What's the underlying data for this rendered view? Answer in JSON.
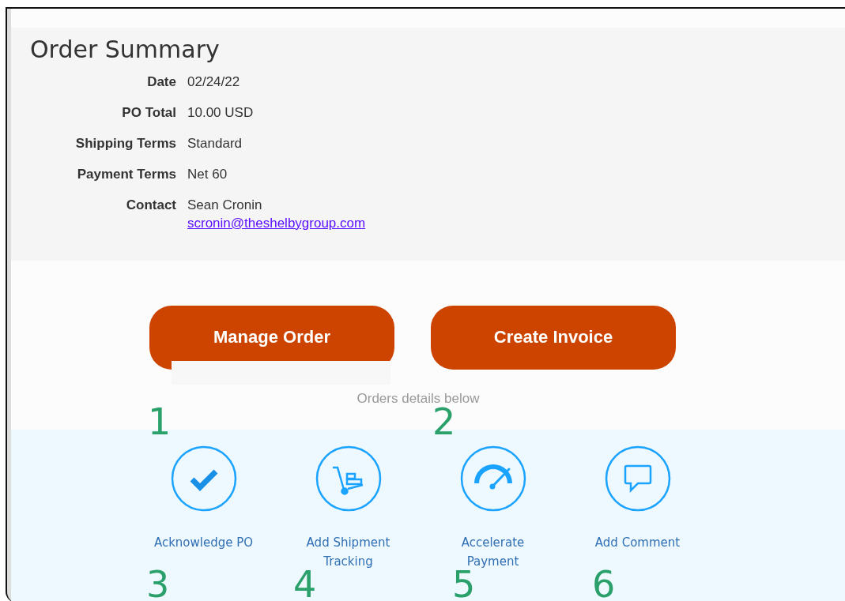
{
  "summary": {
    "title": "Order Summary",
    "fields": [
      {
        "label": "Date",
        "value": "02/24/22"
      },
      {
        "label": "PO Total",
        "value": "10.00 USD"
      },
      {
        "label": "Shipping Terms",
        "value": "Standard"
      },
      {
        "label": "Payment Terms",
        "value": "Net 60"
      },
      {
        "label": "Contact",
        "value": "Sean Cronin",
        "link": "scronin@theshelbygroup.com"
      }
    ]
  },
  "buttons": [
    "Manage Order",
    "Create Invoice"
  ],
  "details_note": "Orders details below",
  "actions": [
    {
      "kind": "check",
      "label": "Acknowledge PO"
    },
    {
      "kind": "cart",
      "label": "Add Shipment Tracking"
    },
    {
      "kind": "gauge",
      "label": "Accelerate Payment"
    },
    {
      "kind": "comment",
      "label": "Add Comment"
    }
  ],
  "annotations": [
    "1",
    "2",
    "3",
    "4",
    "5",
    "6"
  ]
}
